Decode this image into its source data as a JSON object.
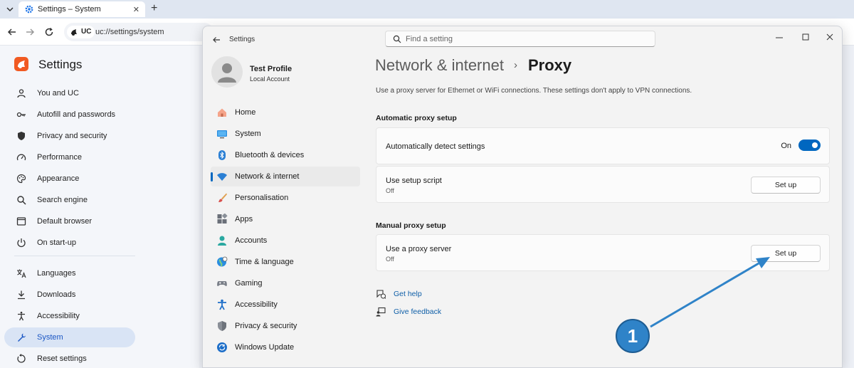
{
  "browser": {
    "tab_title": "Settings – System",
    "tab_close": "✕",
    "new_tab": "+",
    "address_badge": "UC",
    "url": "uc://settings/system"
  },
  "browser_settings": {
    "title": "Settings",
    "items": [
      {
        "label": "You and UC",
        "icon": "person-icon"
      },
      {
        "label": "Autofill and passwords",
        "icon": "key-icon"
      },
      {
        "label": "Privacy and security",
        "icon": "shield-icon"
      },
      {
        "label": "Performance",
        "icon": "speedometer-icon"
      },
      {
        "label": "Appearance",
        "icon": "palette-icon"
      },
      {
        "label": "Search engine",
        "icon": "search-icon"
      },
      {
        "label": "Default browser",
        "icon": "browser-window-icon"
      },
      {
        "label": "On start-up",
        "icon": "power-icon"
      },
      {
        "label": "Languages",
        "icon": "translate-icon"
      },
      {
        "label": "Downloads",
        "icon": "download-icon"
      },
      {
        "label": "Accessibility",
        "icon": "accessibility-icon"
      },
      {
        "label": "System",
        "icon": "wrench-icon",
        "active": true
      },
      {
        "label": "Reset settings",
        "icon": "reset-icon"
      }
    ]
  },
  "window": {
    "title": "Settings",
    "search_placeholder": "Find a setting",
    "profile": {
      "name": "Test Profile",
      "account": "Local Account"
    },
    "nav": [
      {
        "label": "Home",
        "icon": "home-icon"
      },
      {
        "label": "System",
        "icon": "monitor-icon"
      },
      {
        "label": "Bluetooth & devices",
        "icon": "bluetooth-icon"
      },
      {
        "label": "Network & internet",
        "icon": "wifi-icon",
        "active": true
      },
      {
        "label": "Personalisation",
        "icon": "brush-icon"
      },
      {
        "label": "Apps",
        "icon": "apps-icon"
      },
      {
        "label": "Accounts",
        "icon": "account-icon"
      },
      {
        "label": "Time & language",
        "icon": "globe-clock-icon"
      },
      {
        "label": "Gaming",
        "icon": "gamepad-icon"
      },
      {
        "label": "Accessibility",
        "icon": "accessibility-icon"
      },
      {
        "label": "Privacy & security",
        "icon": "shield-icon"
      },
      {
        "label": "Windows Update",
        "icon": "update-icon"
      }
    ]
  },
  "content": {
    "breadcrumb_parent": "Network & internet",
    "breadcrumb_sep": "›",
    "breadcrumb_current": "Proxy",
    "description": "Use a proxy server for Ethernet or WiFi connections. These settings don't apply to VPN connections.",
    "auto_section": "Automatic proxy setup",
    "auto_detect": {
      "label": "Automatically detect settings",
      "state_label": "On",
      "enabled": true
    },
    "setup_script": {
      "label": "Use setup script",
      "status": "Off",
      "button": "Set up"
    },
    "manual_section": "Manual proxy setup",
    "proxy_server": {
      "label": "Use a proxy server",
      "status": "Off",
      "button": "Set up"
    },
    "get_help": "Get help",
    "give_feedback": "Give feedback"
  },
  "annotation": {
    "step_number": "1",
    "color": "#2f83c8"
  }
}
